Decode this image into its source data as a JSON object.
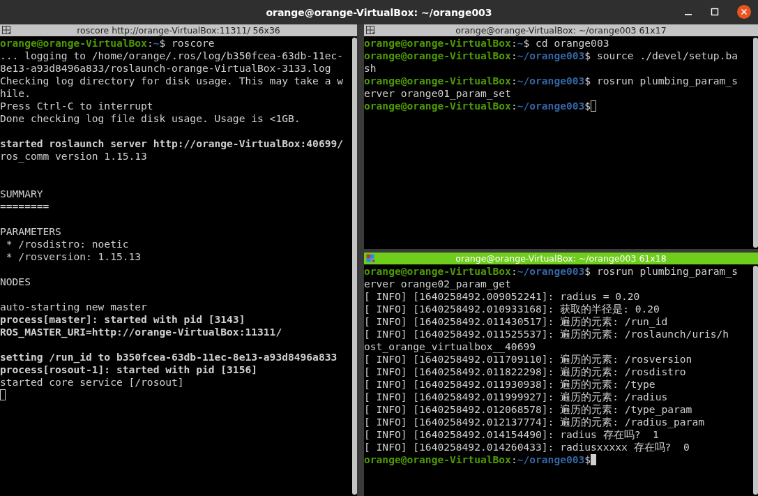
{
  "window": {
    "title": "orange@orange-VirtualBox: ~/orange003"
  },
  "panes": [
    {
      "title": "roscore http://orange-VirtualBox:11311/ 56x36",
      "focused": false,
      "lines": [
        {
          "kind": "text",
          "segments": [
            {
              "text": "orange@orange-VirtualBox",
              "kind": "host"
            },
            {
              "text": ":",
              "kind": "plain"
            },
            {
              "text": "~",
              "kind": "path"
            },
            {
              "text": "$ roscore",
              "kind": "plain"
            }
          ]
        },
        {
          "kind": "text",
          "segments": [
            {
              "text": "... logging to /home/orange/.ros/log/b350fcea-63db-11ec-",
              "kind": "plain"
            }
          ]
        },
        {
          "kind": "text",
          "segments": [
            {
              "text": "8e13-a93d8496a833/roslaunch-orange-VirtualBox-3133.log",
              "kind": "plain"
            }
          ]
        },
        {
          "kind": "text",
          "segments": [
            {
              "text": "Checking log directory for disk usage. This may take a w",
              "kind": "plain"
            }
          ]
        },
        {
          "kind": "text",
          "segments": [
            {
              "text": "hile.",
              "kind": "plain"
            }
          ]
        },
        {
          "kind": "text",
          "segments": [
            {
              "text": "Press Ctrl-C to interrupt",
              "kind": "plain"
            }
          ]
        },
        {
          "kind": "text",
          "segments": [
            {
              "text": "Done checking log file disk usage. Usage is <1GB.",
              "kind": "plain"
            }
          ]
        },
        {
          "kind": "blank"
        },
        {
          "kind": "text",
          "segments": [
            {
              "text": "started roslaunch server http://orange-VirtualBox:40699/",
              "kind": "bold"
            }
          ]
        },
        {
          "kind": "text",
          "segments": [
            {
              "text": "ros_comm version 1.15.13",
              "kind": "plain"
            }
          ]
        },
        {
          "kind": "blank"
        },
        {
          "kind": "blank"
        },
        {
          "kind": "text",
          "segments": [
            {
              "text": "SUMMARY",
              "kind": "plain"
            }
          ]
        },
        {
          "kind": "text",
          "segments": [
            {
              "text": "========",
              "kind": "plain"
            }
          ]
        },
        {
          "kind": "blank"
        },
        {
          "kind": "text",
          "segments": [
            {
              "text": "PARAMETERS",
              "kind": "plain"
            }
          ]
        },
        {
          "kind": "text",
          "segments": [
            {
              "text": " * /rosdistro: noetic",
              "kind": "plain"
            }
          ]
        },
        {
          "kind": "text",
          "segments": [
            {
              "text": " * /rosversion: 1.15.13",
              "kind": "plain"
            }
          ]
        },
        {
          "kind": "blank"
        },
        {
          "kind": "text",
          "segments": [
            {
              "text": "NODES",
              "kind": "plain"
            }
          ]
        },
        {
          "kind": "blank"
        },
        {
          "kind": "text",
          "segments": [
            {
              "text": "auto-starting new master",
              "kind": "plain"
            }
          ]
        },
        {
          "kind": "text",
          "segments": [
            {
              "text": "process[master]: started with pid [3143]",
              "kind": "bold"
            }
          ]
        },
        {
          "kind": "text",
          "segments": [
            {
              "text": "ROS_MASTER_URI=http://orange-VirtualBox:11311/",
              "kind": "bold"
            }
          ]
        },
        {
          "kind": "blank"
        },
        {
          "kind": "text",
          "segments": [
            {
              "text": "setting /run_id to b350fcea-63db-11ec-8e13-a93d8496a833",
              "kind": "bold"
            }
          ]
        },
        {
          "kind": "text",
          "segments": [
            {
              "text": "process[rosout-1]: started with pid [3156]",
              "kind": "bold"
            }
          ]
        },
        {
          "kind": "text",
          "segments": [
            {
              "text": "started core service [/rosout]",
              "kind": "plain"
            }
          ]
        },
        {
          "kind": "blank",
          "cursor": true
        }
      ]
    },
    {
      "title": "orange@orange-VirtualBox: ~/orange003 61x17",
      "focused": false,
      "lines": [
        {
          "kind": "text",
          "segments": [
            {
              "text": "orange@orange-VirtualBox",
              "kind": "host"
            },
            {
              "text": ":",
              "kind": "plain"
            },
            {
              "text": "~",
              "kind": "path"
            },
            {
              "text": "$ cd orange003",
              "kind": "plain"
            }
          ]
        },
        {
          "kind": "text",
          "segments": [
            {
              "text": "orange@orange-VirtualBox",
              "kind": "host"
            },
            {
              "text": ":",
              "kind": "plain"
            },
            {
              "text": "~/orange003",
              "kind": "path"
            },
            {
              "text": "$ source ./devel/setup.ba",
              "kind": "plain"
            }
          ]
        },
        {
          "kind": "text",
          "segments": [
            {
              "text": "sh",
              "kind": "plain"
            }
          ]
        },
        {
          "kind": "text",
          "segments": [
            {
              "text": "orange@orange-VirtualBox",
              "kind": "host"
            },
            {
              "text": ":",
              "kind": "plain"
            },
            {
              "text": "~/orange003",
              "kind": "path"
            },
            {
              "text": "$ rosrun plumbing_param_s",
              "kind": "plain"
            }
          ]
        },
        {
          "kind": "text",
          "segments": [
            {
              "text": "erver orange01_param_set",
              "kind": "plain"
            }
          ]
        },
        {
          "kind": "text",
          "cursor": true,
          "segments": [
            {
              "text": "orange@orange-VirtualBox",
              "kind": "host"
            },
            {
              "text": ":",
              "kind": "plain"
            },
            {
              "text": "~/orange003",
              "kind": "path"
            },
            {
              "text": "$",
              "kind": "plain"
            }
          ]
        }
      ]
    },
    {
      "title": "orange@orange-VirtualBox: ~/orange003 61x18",
      "focused": true,
      "lines": [
        {
          "kind": "text",
          "segments": [
            {
              "text": "orange@orange-VirtualBox",
              "kind": "host"
            },
            {
              "text": ":",
              "kind": "plain"
            },
            {
              "text": "~/orange003",
              "kind": "path"
            },
            {
              "text": "$ rosrun plumbing_param_s",
              "kind": "plain"
            }
          ]
        },
        {
          "kind": "text",
          "segments": [
            {
              "text": "erver orange02_param_get",
              "kind": "plain"
            }
          ]
        },
        {
          "kind": "text",
          "segments": [
            {
              "text": "[ INFO] [1640258492.009052241]: radius = 0.20",
              "kind": "plain"
            }
          ]
        },
        {
          "kind": "text",
          "segments": [
            {
              "text": "[ INFO] [1640258492.010933168]: 获取的半径是: 0.20",
              "kind": "plain"
            }
          ]
        },
        {
          "kind": "text",
          "segments": [
            {
              "text": "[ INFO] [1640258492.011430517]: 遍历的元素: /run_id",
              "kind": "plain"
            }
          ]
        },
        {
          "kind": "text",
          "segments": [
            {
              "text": "[ INFO] [1640258492.011525537]: 遍历的元素: /roslaunch/uris/h",
              "kind": "plain"
            }
          ]
        },
        {
          "kind": "text",
          "segments": [
            {
              "text": "ost_orange_virtualbox__40699",
              "kind": "plain"
            }
          ]
        },
        {
          "kind": "text",
          "segments": [
            {
              "text": "[ INFO] [1640258492.011709110]: 遍历的元素: /rosversion",
              "kind": "plain"
            }
          ]
        },
        {
          "kind": "text",
          "segments": [
            {
              "text": "[ INFO] [1640258492.011822298]: 遍历的元素: /rosdistro",
              "kind": "plain"
            }
          ]
        },
        {
          "kind": "text",
          "segments": [
            {
              "text": "[ INFO] [1640258492.011930938]: 遍历的元素: /type",
              "kind": "plain"
            }
          ]
        },
        {
          "kind": "text",
          "segments": [
            {
              "text": "[ INFO] [1640258492.011999927]: 遍历的元素: /radius",
              "kind": "plain"
            }
          ]
        },
        {
          "kind": "text",
          "segments": [
            {
              "text": "[ INFO] [1640258492.012068578]: 遍历的元素: /type_param",
              "kind": "plain"
            }
          ]
        },
        {
          "kind": "text",
          "segments": [
            {
              "text": "[ INFO] [1640258492.012137774]: 遍历的元素: /radius_param",
              "kind": "plain"
            }
          ]
        },
        {
          "kind": "text",
          "segments": [
            {
              "text": "[ INFO] [1640258492.014154490]: radius 存在吗?  1",
              "kind": "plain"
            }
          ]
        },
        {
          "kind": "text",
          "segments": [
            {
              "text": "[ INFO] [1640258492.014260433]: radiusxxxxx 存在吗?  0",
              "kind": "plain"
            }
          ]
        },
        {
          "kind": "text",
          "cursor": true,
          "segments": [
            {
              "text": "orange@orange-VirtualBox",
              "kind": "host"
            },
            {
              "text": ":",
              "kind": "plain"
            },
            {
              "text": "~/orange003",
              "kind": "path"
            },
            {
              "text": "$",
              "kind": "plain"
            }
          ]
        }
      ]
    }
  ]
}
